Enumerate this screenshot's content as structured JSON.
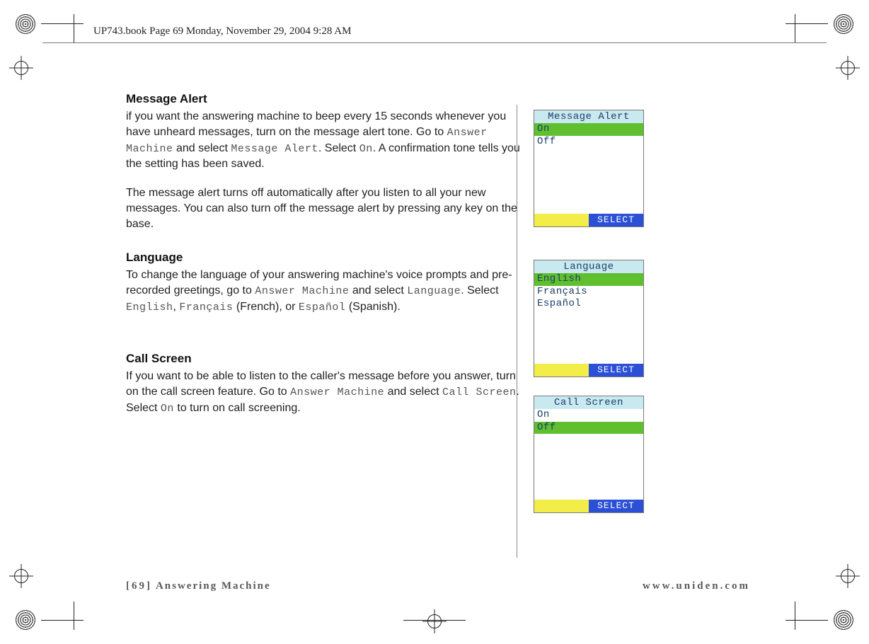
{
  "header": {
    "running_head": "UP743.book  Page 69  Monday, November 29, 2004  9:28 AM"
  },
  "sections": {
    "message_alert": {
      "title": "Message Alert",
      "p1_a": "if you want the answering machine to beep every 15 seconds whenever you have unheard messages, turn on the message alert tone. Go to ",
      "p1_m1": "Answer Machine",
      "p1_b": " and select ",
      "p1_m2": "Message Alert",
      "p1_c": ". Select ",
      "p1_m3": "On",
      "p1_d": ". A confirmation tone tells you the setting has been saved.",
      "p2": "The message alert turns off automatically after you listen to all your new messages. You can also turn off the message alert by pressing any key on the base."
    },
    "language": {
      "title": "Language",
      "p1_a": "To change the language of your answering machine's voice prompts and pre-recorded greetings, go to ",
      "p1_m1": "Answer Machine",
      "p1_b": " and select ",
      "p1_m2": "Language",
      "p1_c": ". Select ",
      "p1_m3": "English",
      "p1_d": ", ",
      "p1_m4": "Français",
      "p1_e": " (French), or ",
      "p1_m5": "Español",
      "p1_f": " (Spanish)."
    },
    "call_screen": {
      "title": "Call Screen",
      "p1_a": "If you want to be able to listen to the caller's message before you answer, turn on the call screen feature. Go to ",
      "p1_m1": "Answer Machine",
      "p1_b": " and select ",
      "p1_m2": "Call Screen",
      "p1_c": ". Select ",
      "p1_m3": "On",
      "p1_d": " to turn on call screening."
    }
  },
  "screens": {
    "msg_alert": {
      "title": "Message Alert",
      "opts": [
        "On",
        "Off"
      ],
      "selected": 0,
      "softkey": "SELECT"
    },
    "language": {
      "title": "Language",
      "opts": [
        "English",
        "Français",
        "Español"
      ],
      "selected": 0,
      "softkey": "SELECT"
    },
    "callscreen": {
      "title": "Call Screen",
      "opts": [
        "On",
        "Off"
      ],
      "selected": 1,
      "softkey": "SELECT"
    }
  },
  "footer": {
    "page_num": "[69]",
    "section": "Answering Machine",
    "url": "www.uniden.com"
  }
}
